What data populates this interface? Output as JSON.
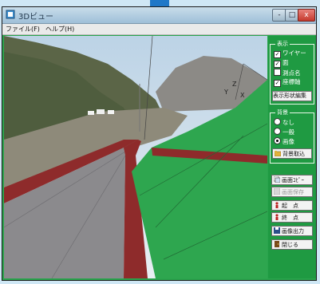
{
  "window": {
    "title": "3Dビュー",
    "controls": {
      "minimize": "-",
      "maximize": "□",
      "close": "x"
    }
  },
  "menu": [
    "ファイル(F)",
    "ヘルプ(H)"
  ],
  "viewport": {
    "axes": {
      "z": "Z",
      "y": "Y",
      "x": "X"
    }
  },
  "panel": {
    "display": {
      "title": "表示",
      "items": [
        {
          "label": "ワイヤー",
          "checked": true
        },
        {
          "label": "面",
          "checked": true
        },
        {
          "label": "測点名",
          "checked": false
        },
        {
          "label": "座標軸",
          "checked": true
        }
      ],
      "state_button": "表示形状編集"
    },
    "background": {
      "title": "背景",
      "options": [
        {
          "label": "なし",
          "selected": false
        },
        {
          "label": "一般",
          "selected": false
        },
        {
          "label": "画像",
          "selected": true
        }
      ],
      "load_button": "背景取込"
    },
    "buttons": [
      {
        "label": "画面ｺﾋﾟｰ",
        "enabled": true
      },
      {
        "label": "画面保存",
        "enabled": false
      },
      {
        "label": "起　点",
        "enabled": true
      },
      {
        "label": "終　点",
        "enabled": true
      },
      {
        "label": "画像出力",
        "enabled": true
      },
      {
        "label": "閉じる",
        "enabled": true
      }
    ]
  }
}
